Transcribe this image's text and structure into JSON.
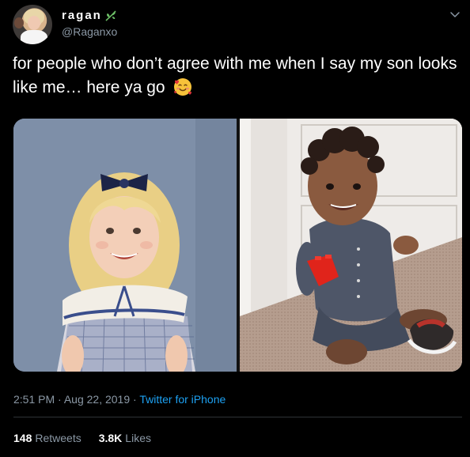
{
  "user": {
    "display_name": "ragan",
    "handle": "@Raganxo"
  },
  "tweet": {
    "text": "for people who don’t agree with me when I say my son looks like me… here ya go",
    "emoji": "smiling-face-with-hearts"
  },
  "meta": {
    "time": "2:51 PM",
    "sep1": "·",
    "date": "Aug 22, 2019",
    "sep2": "·",
    "source": "Twitter for iPhone"
  },
  "stats": {
    "retweets_count": "148",
    "retweets_label": "Retweets",
    "likes_count": "3.8K",
    "likes_label": "Likes"
  },
  "colors": {
    "background": "#000000",
    "text": "#ffffff",
    "muted": "#8b98a5",
    "link": "#1da1f2"
  },
  "icons": [
    "leaf-icon",
    "chevron-down-icon",
    "smiling-face-with-hearts-emoji"
  ]
}
